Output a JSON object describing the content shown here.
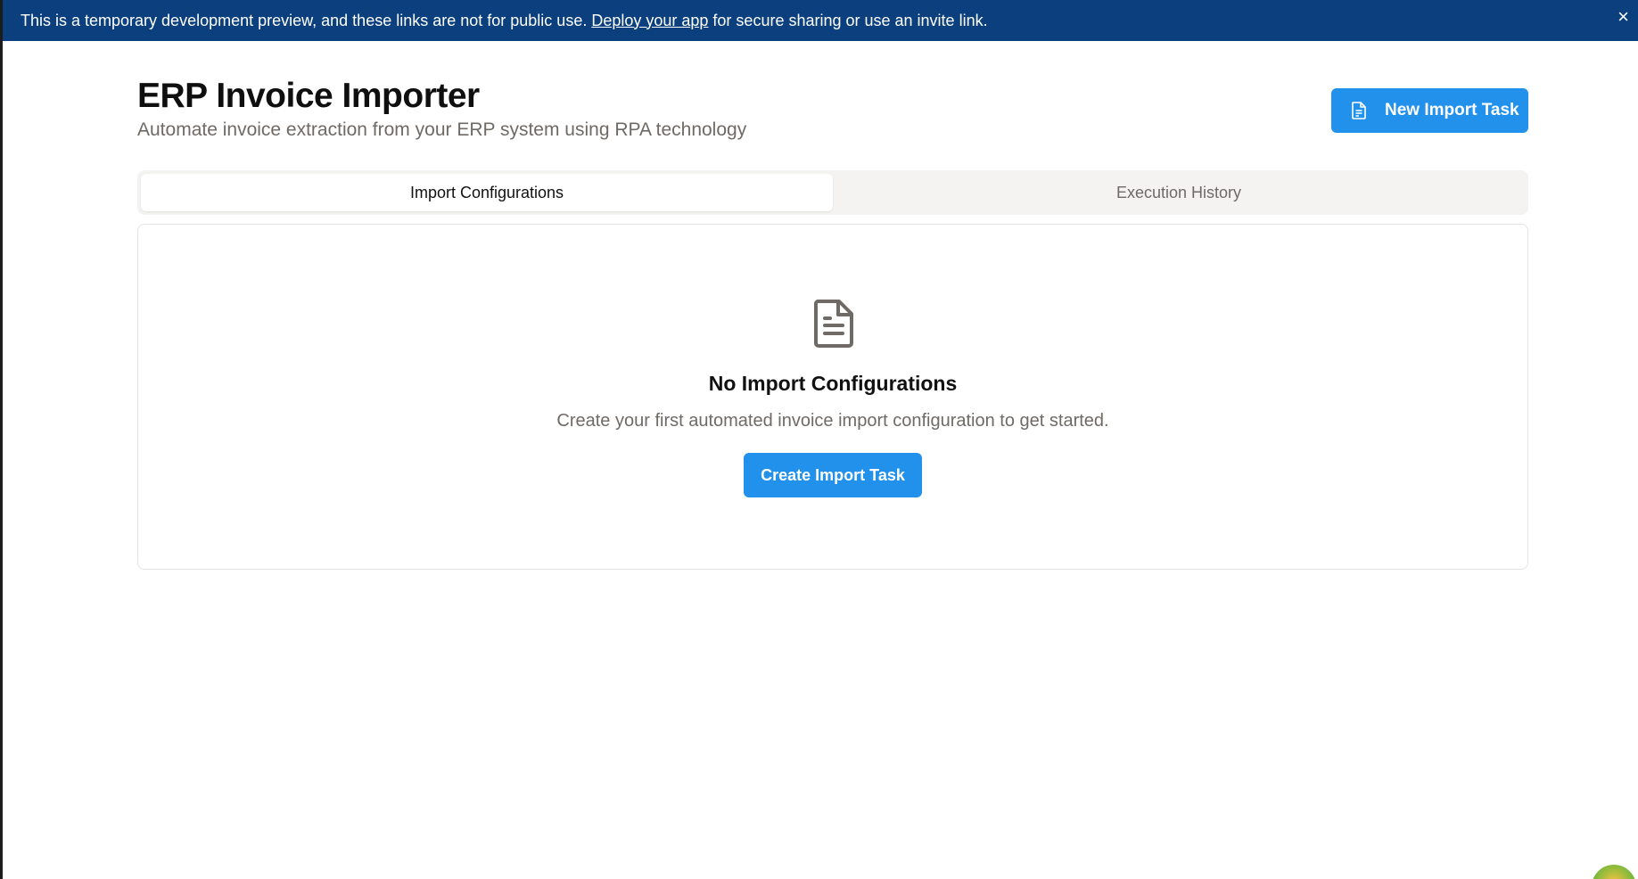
{
  "banner": {
    "text_before": "This is a temporary development preview, and these links are not for public use.",
    "link_text": "Deploy your app",
    "text_after": "for secure sharing or use an invite link.",
    "close_glyph": "×",
    "background": "#0b3f7d"
  },
  "header": {
    "title": "ERP Invoice Importer",
    "subtitle": "Automate invoice extraction from your ERP system using RPA technology",
    "new_task_button": {
      "label": "New Import Task",
      "icon": "file-text-icon"
    }
  },
  "tabs": [
    {
      "label": "Import Configurations",
      "active": true
    },
    {
      "label": "Execution History",
      "active": false
    }
  ],
  "empty_state": {
    "icon": "file-text-icon",
    "title": "No Import Configurations",
    "description": "Create your first automated invoice import configuration to get started.",
    "button_label": "Create Import Task"
  },
  "colors": {
    "accent": "#2191ec",
    "banner": "#0b3f7d",
    "muted_text": "#6f6a66",
    "tab_bar_bg": "#f4f3f1"
  },
  "corner_widget": {
    "icon": "app-badge-icon"
  }
}
